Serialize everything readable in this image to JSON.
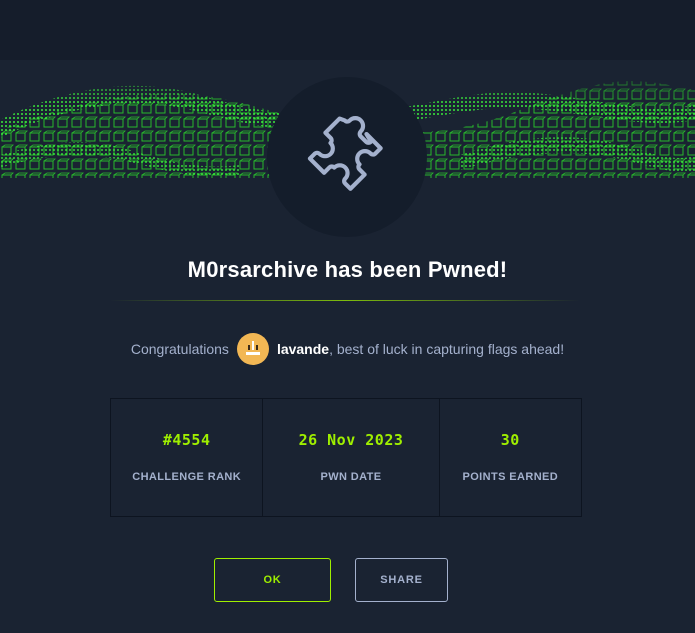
{
  "header": {
    "banner": "green-wave-cubes-banner",
    "icon": "puzzle-piece-icon"
  },
  "modal": {
    "title": "M0rsarchive has been Pwned!",
    "congrats_prefix": "Congratulations",
    "username": "lavande",
    "congrats_suffix": ", best of luck in capturing flags ahead!",
    "avatar_icon": "user-avatar-icon"
  },
  "stats": [
    {
      "value": "#4554",
      "label": "CHALLENGE RANK"
    },
    {
      "value": "26 Nov 2023",
      "label": "PWN DATE"
    },
    {
      "value": "30",
      "label": "POINTS EARNED"
    }
  ],
  "buttons": {
    "ok_label": "OK",
    "share_label": "SHARE"
  },
  "colors": {
    "accent": "#9fef00",
    "background": "#1a2332",
    "text_muted": "#a4b1cd"
  }
}
